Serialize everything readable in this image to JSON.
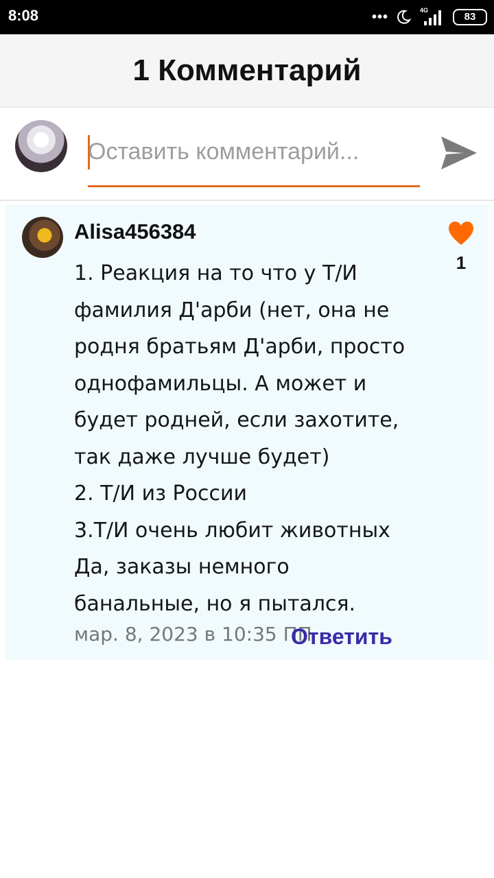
{
  "status_bar": {
    "time": "8:08",
    "network": "4G",
    "battery": "83",
    "icons": [
      "more-dots-icon",
      "moon-icon",
      "signal-icon",
      "battery-icon"
    ]
  },
  "header": {
    "title": "1 Комментарий"
  },
  "compose": {
    "placeholder": "Оставить комментарий...",
    "value": "",
    "accent_color": "#e46a20",
    "send_icon": "send-icon"
  },
  "comments": [
    {
      "author": "Alisa456384",
      "text": "1. Реакция на то что у Т/И\nфамилия Д'арби (нет, она не\nродня братьям Д'арби, просто\nоднофамильцы. А может и\nбудет родней, если захотите,\nтак даже  лучше будет)\n2. Т/И из России\n3.Т/И очень любит животных\nДа, заказы немного\nбанальные, но я пытался.",
      "timestamp": "мар. 8, 2023 в 10:35 ПП",
      "reply_label": "Ответить",
      "likes": "1",
      "like_color": "#ff6a00",
      "card_bg": "#f1fbfd"
    }
  ]
}
